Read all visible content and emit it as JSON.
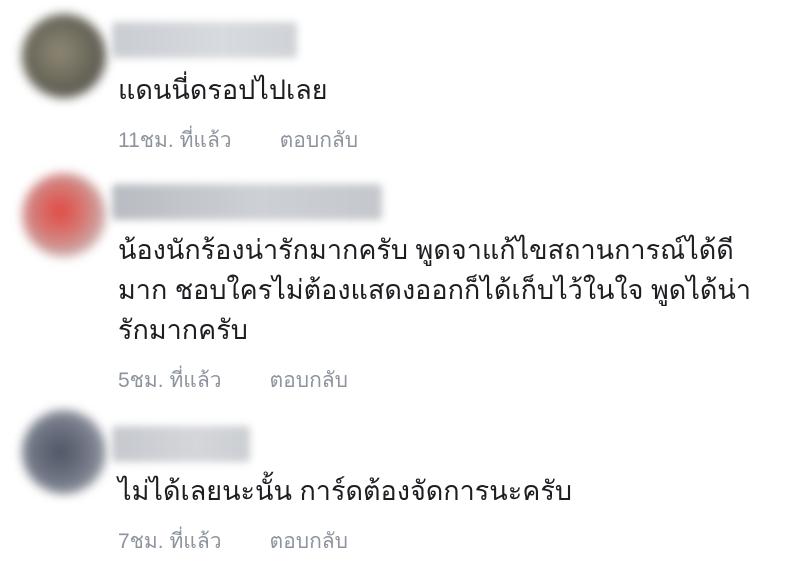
{
  "comments": [
    {
      "text": "แดนนี่ดรอปไปเลย",
      "time": "11ชม. ที่แล้ว",
      "reply": "ตอบกลับ"
    },
    {
      "text": "น้องนักร้องน่ารักมากครับ พูดจาแก้ไขสถานการณ์ได้ดีมาก ชอบใครไม่ต้องแสดงออกก็ได้เก็บไว้ในใจ พูดได้น่ารักมากครับ",
      "time": "5ชม. ที่แล้ว",
      "reply": "ตอบกลับ"
    },
    {
      "text": "ไม่ได้เลยนะนั้น การ์ดต้องจัดการนะครับ",
      "time": "7ชม. ที่แล้ว",
      "reply": "ตอบกลับ"
    }
  ]
}
